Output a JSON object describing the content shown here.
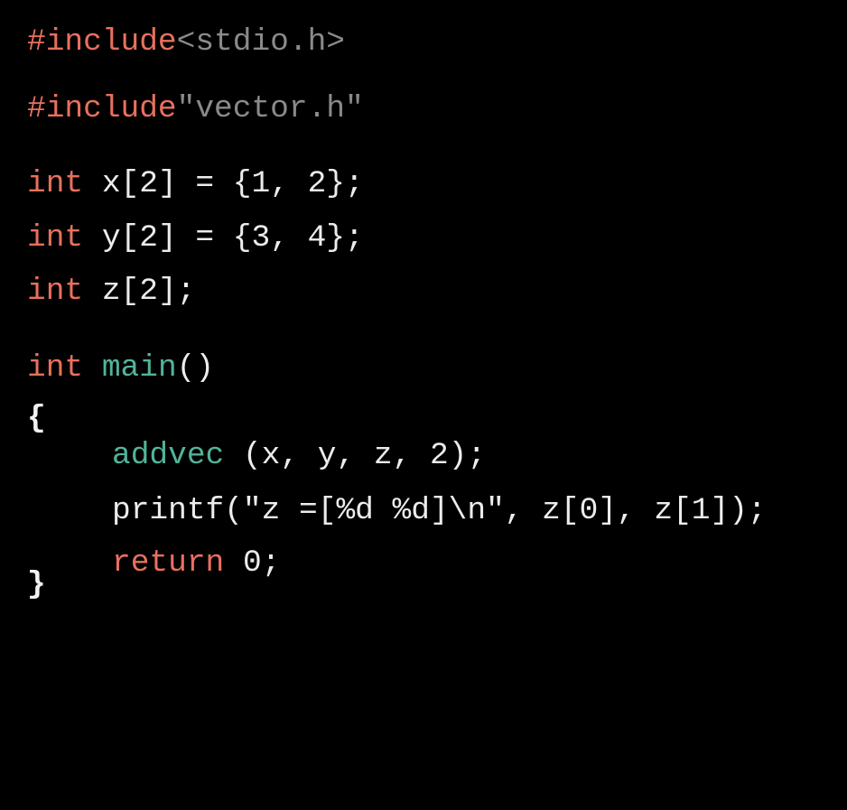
{
  "colors": {
    "background": "#000000",
    "keyword": "#e8705e",
    "function": "#52b39a",
    "include_path": "#8a8a8a",
    "text": "#ececec"
  },
  "code": {
    "l1": {
      "kw": "#include",
      "path": "<stdio.h>"
    },
    "l2": {
      "kw": "#include",
      "path": "\"vector.h\""
    },
    "l3": {
      "kw": "int",
      "rest": " x[2] = {1, 2};"
    },
    "l4": {
      "kw": "int",
      "rest": " y[2] = {3, 4};"
    },
    "l5": {
      "kw": "int",
      "rest": " z[2];"
    },
    "l6": {
      "kw": "int",
      "space": " ",
      "fn": "main",
      "rest": "()"
    },
    "l7": {
      "brace": "{"
    },
    "l8": {
      "fn": "addvec",
      "rest": " (x, y, z, 2);"
    },
    "l9": {
      "text": "printf(\"z =[%d %d]\\n\", z[0], z[1]);"
    },
    "l10": {
      "kw": "return",
      "rest": " 0;"
    },
    "l11": {
      "brace": "}"
    }
  }
}
